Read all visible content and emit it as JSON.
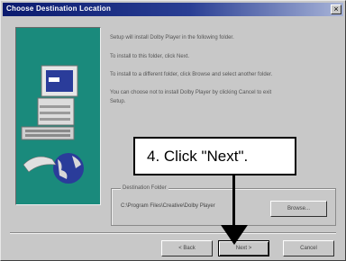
{
  "window": {
    "title": "Choose Destination Location",
    "close_glyph": "×"
  },
  "instructions": [
    "Setup will install Dolby Player in the following folder.",
    "To install to this folder, click Next.",
    "To install to a different folder, click Browse and select another folder.",
    "You can choose not to install Dolby Player by clicking Cancel to exit",
    "Setup."
  ],
  "destination": {
    "legend": "Destination Folder",
    "path": "C:\\Program Files\\Creative\\Dolby Player",
    "browse_label": "Browse..."
  },
  "buttons": {
    "back": "< Back",
    "next": "Next >",
    "cancel": "Cancel"
  },
  "callout": {
    "text": "4. Click \"Next\"."
  },
  "icons": [
    "computer-icon",
    "globe-icon",
    "arrow-icon"
  ],
  "colors": {
    "title_bar": "#0a1a6e",
    "side_panel": "#1a8a7c",
    "dialog": "#c8c8c8"
  }
}
